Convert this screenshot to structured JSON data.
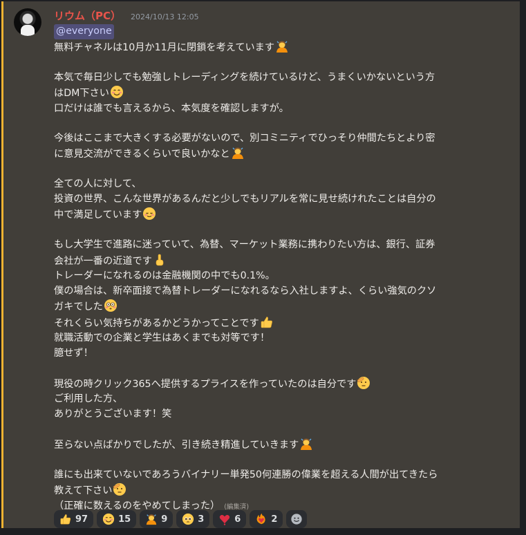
{
  "author": {
    "name": "リウム（PC）",
    "timestamp": "2024/10/13 12:05"
  },
  "mention": "@everyone",
  "lines": [
    {
      "text": "無料チャネルは10月か11月に閉鎖を考えています",
      "emoji": "person-bowing-icon"
    },
    {
      "text": ""
    },
    {
      "text": "本気で毎日少しでも勉強しトレーディングを続けているけど、うまくいかないという方"
    },
    {
      "text": "はDM下さい",
      "emoji": "smiling-face-icon"
    },
    {
      "text": "口だけは誰でも言えるから、本気度を確認しますが。"
    },
    {
      "text": ""
    },
    {
      "text": "今後はここまで大きくする必要がないので、別コミニティでひっそり仲間たちとより密"
    },
    {
      "text": "に意見交流ができるくらいで良いかなと",
      "emoji": "person-bowing-icon"
    },
    {
      "text": ""
    },
    {
      "text": "全ての人に対して、"
    },
    {
      "text": "投資の世界、こんな世界があるんだと少しでもリアルを常に見せ続けれたことは自分の"
    },
    {
      "text": "中で満足しています",
      "emoji": "relieved-face-icon"
    },
    {
      "text": ""
    },
    {
      "text": "もし大学生で進路に迷っていて、為替、マーケット業務に携わりたい方は、銀行、証券"
    },
    {
      "text": "会社が一番の近道です",
      "emoji": "point-up-icon"
    },
    {
      "text": "トレーダーになれるのは金融機関の中でも0.1%。"
    },
    {
      "text": "僕の場合は、新卒面接で為替トレーダーになれるなら入社しますよ、くらい強気のクソ"
    },
    {
      "text": "ガキでした",
      "emoji": "flushed-face-icon"
    },
    {
      "text": "それくらい気持ちがあるかどうかってことです",
      "emoji": "thumbs-up-icon"
    },
    {
      "text": "就職活動での企業と学生はあくまでも対等です！"
    },
    {
      "text": "臆せず！"
    },
    {
      "text": ""
    },
    {
      "text": "現役の時クリック365へ提供するプライスを作っていたのは自分です",
      "emoji": "saluting-face-icon"
    },
    {
      "text": "ご利用した方、"
    },
    {
      "text": "ありがとうございます！笑"
    },
    {
      "text": ""
    },
    {
      "text": "至らない点ばかりでしたが、引き続き精進していきます",
      "emoji": "person-bowing-icon"
    },
    {
      "text": ""
    },
    {
      "text": "誰にも出来ていないであろうバイナリー単発50何連勝の偉業を超える人間が出てきたら"
    },
    {
      "text": "教えて下さい",
      "emoji": "saluting-face-icon"
    },
    {
      "text": "（正確に数えるのをやめてしまった）",
      "edited": "(編集済)"
    }
  ],
  "reactions": [
    {
      "icon": "thumbs-up-icon",
      "count": "97"
    },
    {
      "icon": "smiling-face-icon",
      "count": "15"
    },
    {
      "icon": "person-bowing-icon",
      "count": "9"
    },
    {
      "icon": "pleading-face-icon",
      "count": "3"
    },
    {
      "icon": "heart-exclamation-icon",
      "count": "6"
    },
    {
      "icon": "heart-on-fire-icon",
      "count": "2"
    }
  ],
  "add_reaction_icon": "add-reaction-icon",
  "colors": {
    "username": "#e8544b",
    "message_bg": "#413e39",
    "highlight_bar": "#f0b232",
    "mention_bg": "#514f79"
  }
}
